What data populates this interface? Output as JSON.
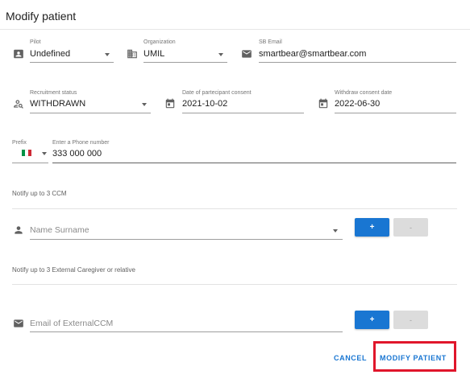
{
  "dialog": {
    "title": "Modify patient"
  },
  "colors": {
    "primary": "#1976d2",
    "highlight": "#e0162b",
    "flag_green": "#009246",
    "flag_white": "#ffffff",
    "flag_red": "#ce2b37"
  },
  "row1": {
    "pilot": {
      "label": "Pilot",
      "value": "Undefined",
      "icon": "badge-icon"
    },
    "organization": {
      "label": "Organization",
      "value": "UMIL",
      "icon": "building-icon"
    },
    "sb_email": {
      "label": "SB Email",
      "value": "smartbear@smartbear.com",
      "icon": "mail-icon"
    }
  },
  "row2": {
    "recruitment_status": {
      "label": "Recruitment status",
      "value": "WITHDRAWN",
      "icon": "person-search-icon"
    },
    "consent_date": {
      "label": "Date of partecipant consent",
      "value": "2021-10-02",
      "icon": "calendar-icon"
    },
    "withdraw_date": {
      "label": "Withdraw consent date",
      "value": "2022-06-30",
      "icon": "calendar-icon"
    }
  },
  "phone": {
    "prefix_label": "Prefix",
    "number_label": "Enter a Phone number",
    "number_value": "333 000 000",
    "flag": "italy-flag"
  },
  "ccm": {
    "section_label": "Notify up to 3 CCM",
    "placeholder": "Name Surname",
    "icon": "person-icon",
    "add_label": "+",
    "remove_label": "-"
  },
  "external": {
    "section_label": "Notify up to 3 External Caregiver or relative",
    "placeholder": "Email of ExternalCCM",
    "icon": "mail-icon",
    "add_label": "+",
    "remove_label": "-"
  },
  "actions": {
    "cancel": "CANCEL",
    "modify": "MODIFY PATIENT"
  }
}
